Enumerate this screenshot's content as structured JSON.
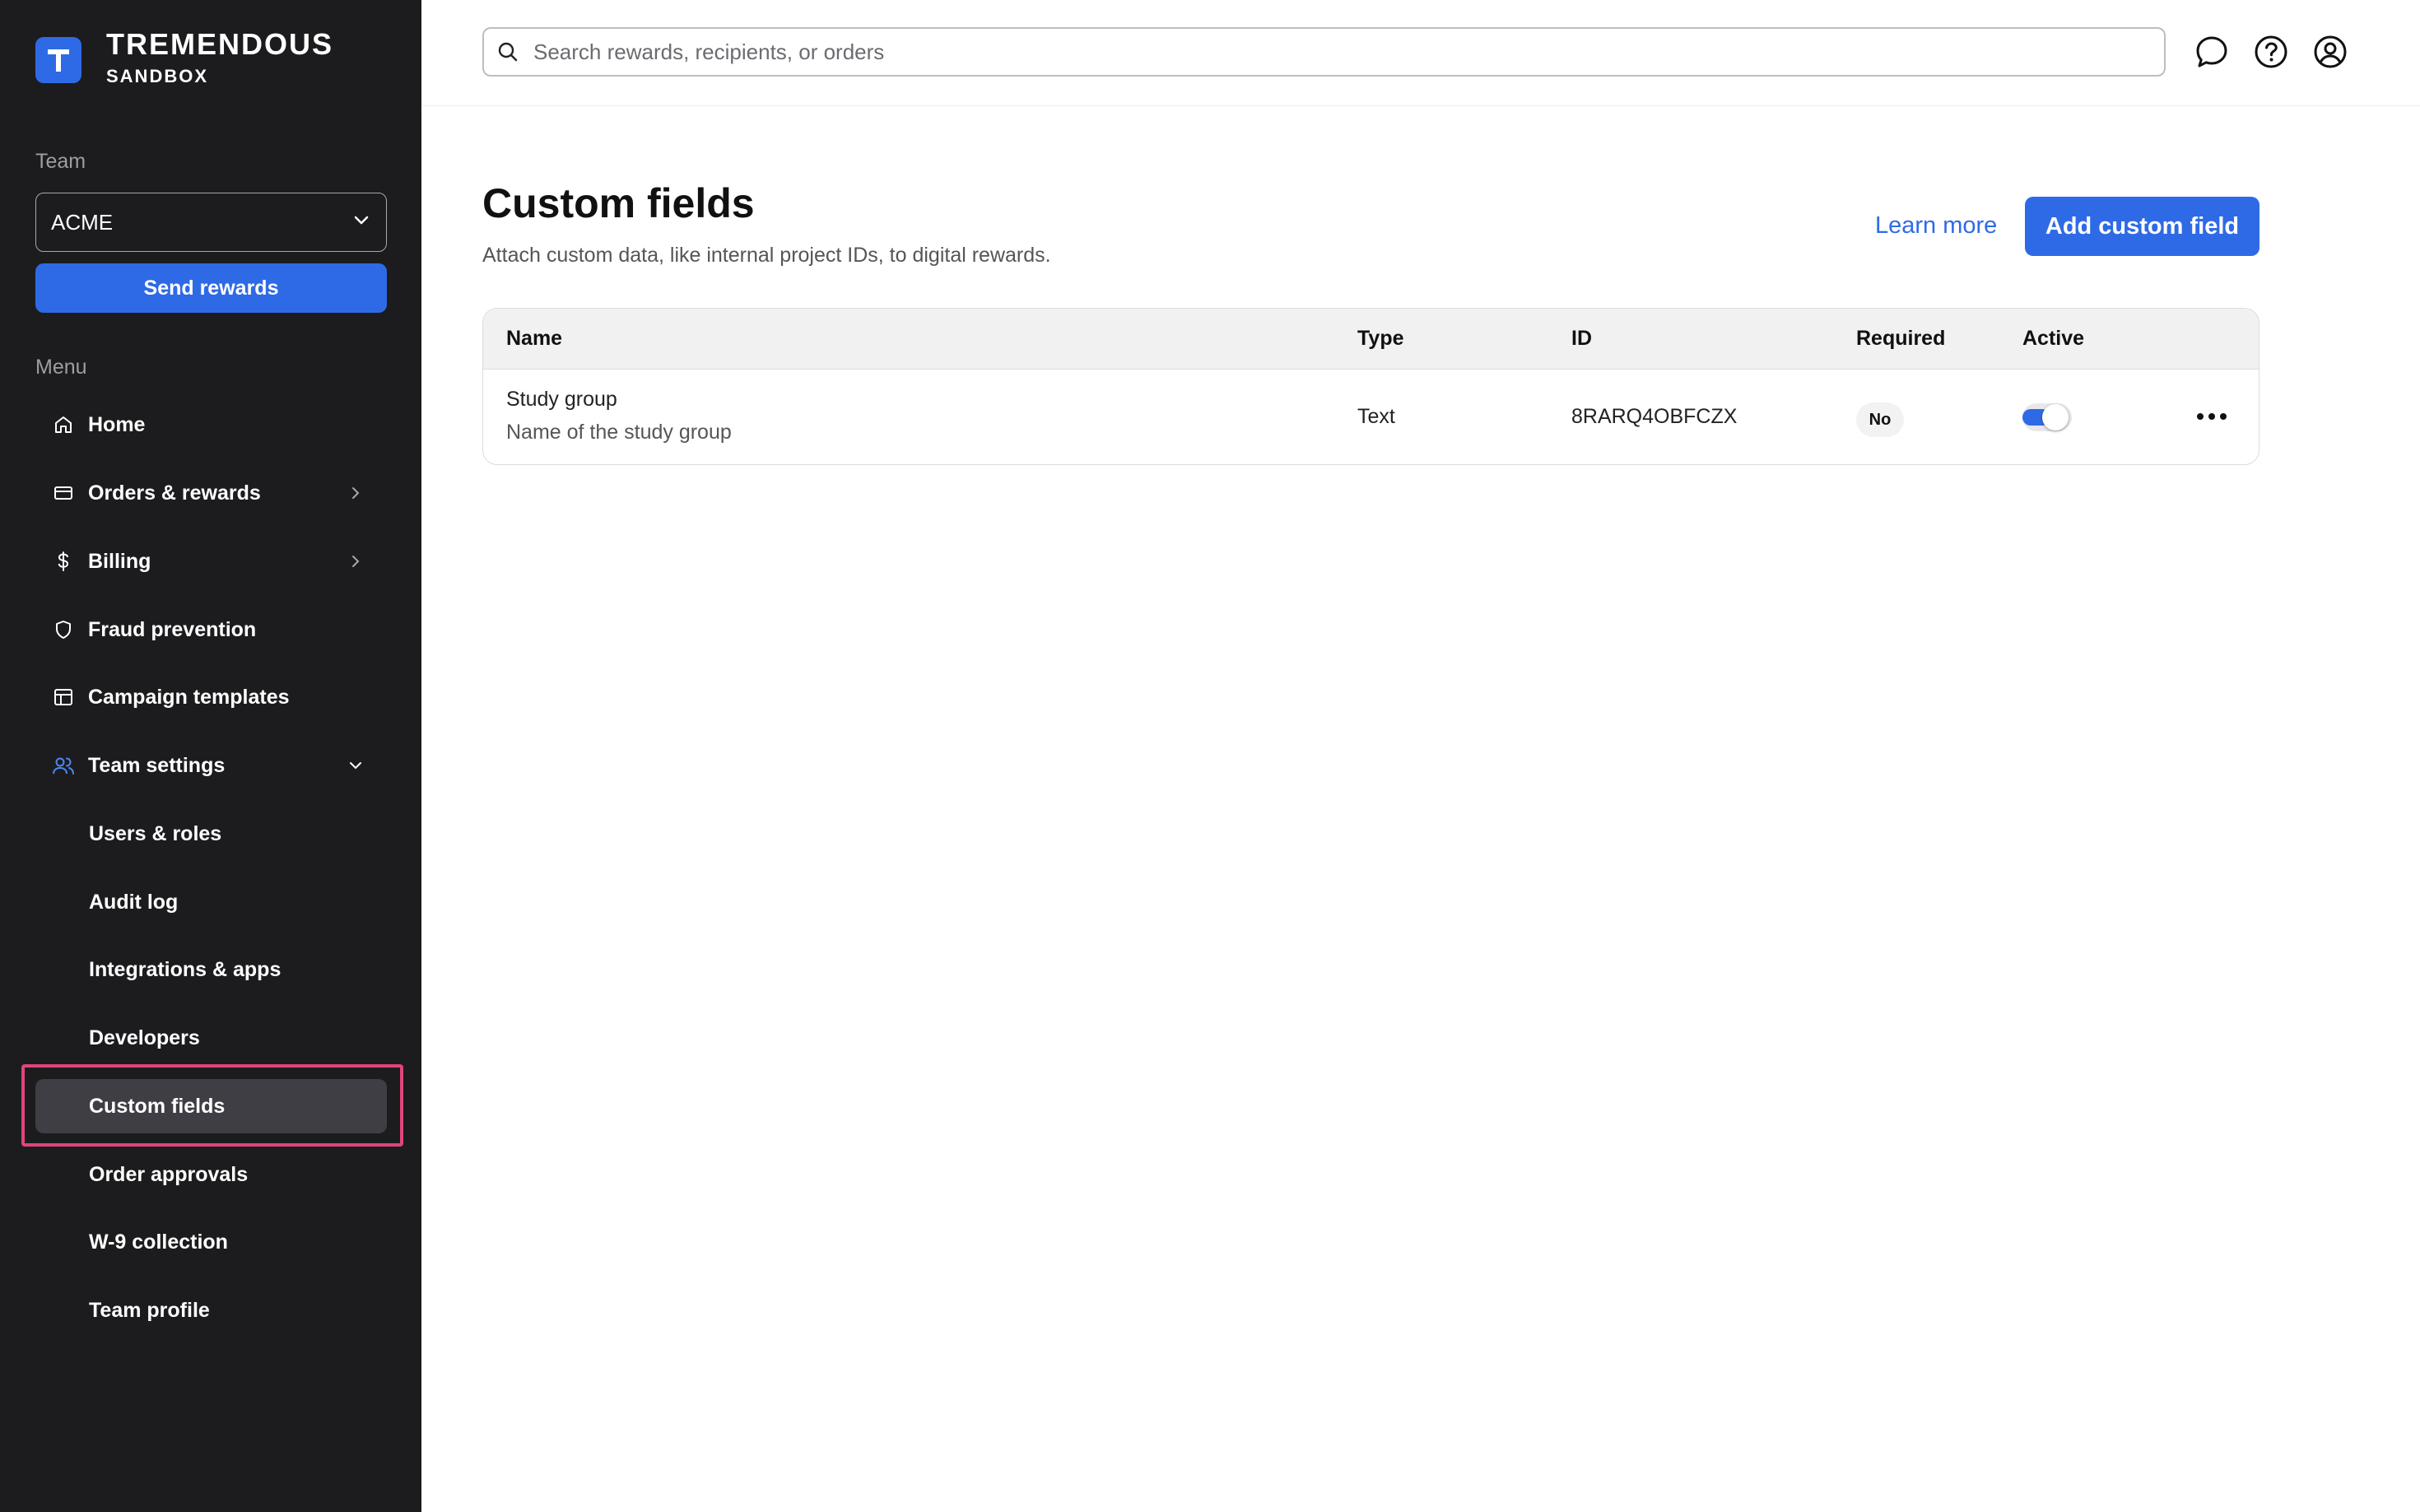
{
  "brand": {
    "name": "TREMENDOUS",
    "env": "SANDBOX",
    "logo_letter": "T"
  },
  "sidebar": {
    "team_label": "Team",
    "team_value": "ACME",
    "send_rewards": "Send rewards",
    "menu_label": "Menu",
    "items": [
      {
        "label": "Home",
        "icon": "home-icon"
      },
      {
        "label": "Orders & rewards",
        "icon": "card-icon"
      },
      {
        "label": "Billing",
        "icon": "dollar-icon"
      },
      {
        "label": "Fraud prevention",
        "icon": "shield-icon"
      },
      {
        "label": "Campaign templates",
        "icon": "layout-icon"
      },
      {
        "label": "Team settings",
        "icon": "users-icon"
      }
    ],
    "sub_items": [
      {
        "label": "Users & roles"
      },
      {
        "label": "Audit log"
      },
      {
        "label": "Integrations & apps"
      },
      {
        "label": "Developers"
      },
      {
        "label": "Custom fields",
        "active": true
      },
      {
        "label": "Order approvals"
      },
      {
        "label": "W-9 collection"
      },
      {
        "label": "Team profile"
      }
    ]
  },
  "search": {
    "placeholder": "Search rewards, recipients, or orders"
  },
  "page": {
    "title": "Custom fields",
    "subtitle": "Attach custom data, like internal project IDs, to digital rewards.",
    "learn_more": "Learn more",
    "add_button": "Add custom field"
  },
  "table": {
    "headers": {
      "name": "Name",
      "type": "Type",
      "id": "ID",
      "required": "Required",
      "active": "Active"
    },
    "rows": [
      {
        "name": "Study group",
        "description": "Name of the study group",
        "type": "Text",
        "id": "8RARQ4OBFCZX",
        "required": "No",
        "active": true
      }
    ]
  },
  "colors": {
    "accent": "#2f6ae6",
    "sidebar_bg": "#1c1c1e",
    "highlight": "#e0457b"
  }
}
